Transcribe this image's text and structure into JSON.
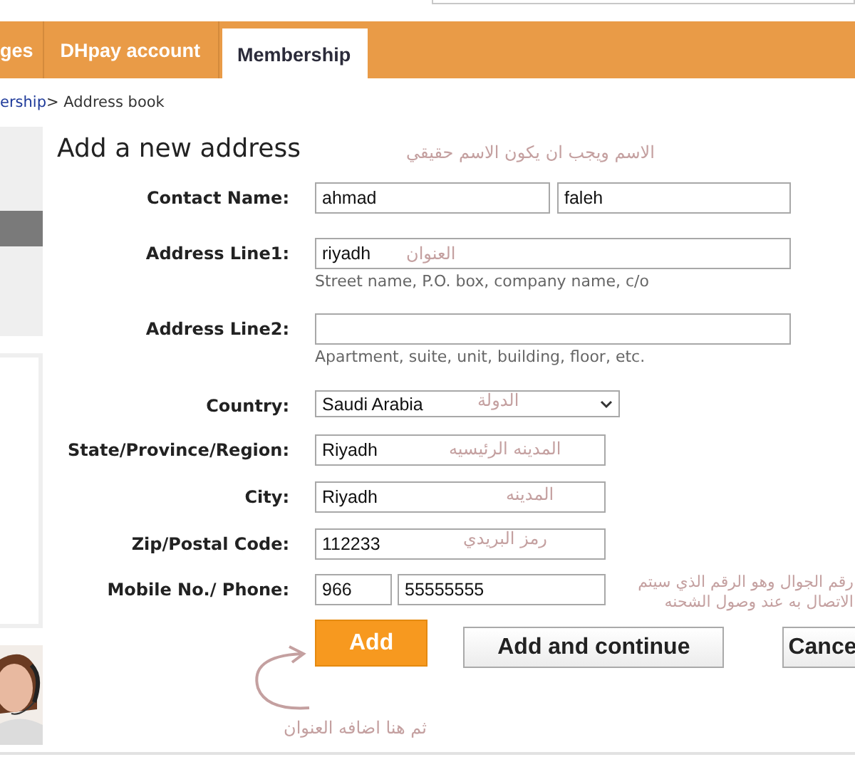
{
  "tabs": [
    {
      "label": "ges",
      "selected": false
    },
    {
      "label": "DHpay account",
      "selected": false
    },
    {
      "label": "Membership",
      "selected": true
    }
  ],
  "breadcrumb": {
    "link": "ership",
    "current": "> Address book"
  },
  "form": {
    "title": "Add a new address",
    "rows": [
      {
        "kind": "name",
        "label": "Contact Name:",
        "values": [
          "ahmad",
          "faleh"
        ],
        "note": "الاسم ويجب ان يكون الاسم حقيقي"
      },
      {
        "kind": "text",
        "label": "Address Line1:",
        "values": [
          "riyadh"
        ],
        "hint": "Street name, P.O. box, company name, c/o",
        "note": "العنوان"
      },
      {
        "kind": "text",
        "label": "Address Line2:",
        "values": [],
        "hint": "Apartment, suite, unit, building, floor, etc."
      },
      {
        "kind": "select",
        "label": "Country:",
        "values": [
          "Saudi Arabia"
        ],
        "note": "الدولة"
      },
      {
        "kind": "short",
        "label": "State/Province/Region:",
        "values": [
          "Riyadh"
        ],
        "note": "المدينه الرئيسيه"
      },
      {
        "kind": "short",
        "label": "City:",
        "values": [
          "Riyadh"
        ],
        "note": "المدينه"
      },
      {
        "kind": "short",
        "label": "Zip/Postal Code:",
        "values": [
          "112233"
        ],
        "note": "رمز البريدي"
      },
      {
        "kind": "phone",
        "label": "Mobile No./ Phone:",
        "values": [
          "966",
          "55555555"
        ],
        "note": "رقم الجوال وهو الرقم الذي سيتم الاتصال به عند وصول الشحنه"
      }
    ],
    "buttons": [
      {
        "kind": "primary",
        "label": "Add"
      },
      {
        "kind": "secondary",
        "label": "Add and continue"
      },
      {
        "kind": "secondary",
        "label": "Cance"
      }
    ],
    "button_note": "ثم هنا اضافه العنوان"
  }
}
